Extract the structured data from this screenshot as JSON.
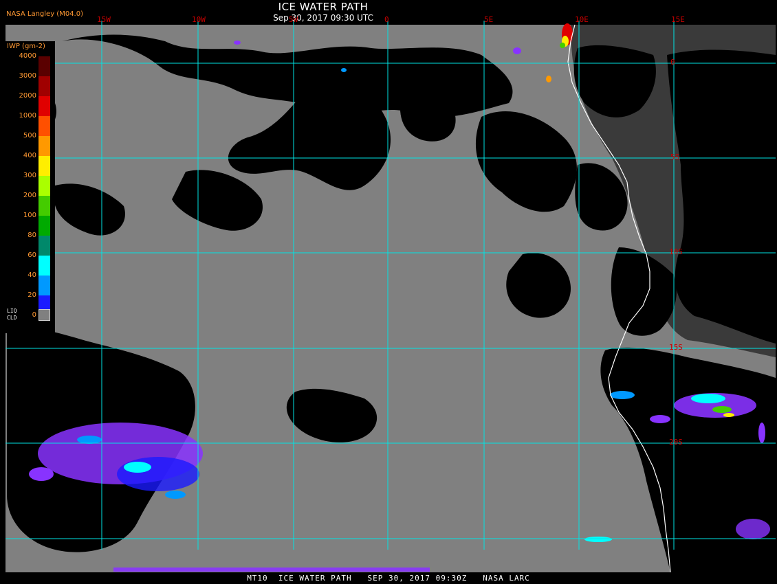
{
  "header": {
    "title": "ICE WATER PATH",
    "subtitle": "Sep 30, 2017 09:30 UTC",
    "producer": "NASA Langley (M04.0)"
  },
  "map": {
    "longitude_labels": [
      "15W",
      "10W",
      "5W",
      "0",
      "5E",
      "10E",
      "15E"
    ],
    "latitude_labels": [
      "0",
      "5S",
      "10S",
      "15S",
      "20S"
    ],
    "grid_color": "#00e5e5",
    "label_color": "#cc0000",
    "ice_free_cloud_color": "#808080",
    "clear_sky_color": "#000000",
    "coastline_color": "#ffffff"
  },
  "legend": {
    "title": "IWP (gm-2)",
    "ticks": [
      "4000",
      "3000",
      "2000",
      "1000",
      "500",
      "400",
      "300",
      "200",
      "100",
      "80",
      "60",
      "40",
      "20",
      "0"
    ],
    "colors": [
      "#5a0000",
      "#a00000",
      "#e00000",
      "#ff5000",
      "#ff9900",
      "#ffee00",
      "#aaff00",
      "#44cc00",
      "#00aa00",
      "#00886a",
      "#00ffff",
      "#0099ff",
      "#1a1aff",
      "#8833ff"
    ],
    "liq_label": "LIQ",
    "cld_label": "CLD"
  },
  "footer": {
    "text": "MT10  ICE WATER PATH   SEP 30, 2017 09:30Z   NASA LARC"
  }
}
